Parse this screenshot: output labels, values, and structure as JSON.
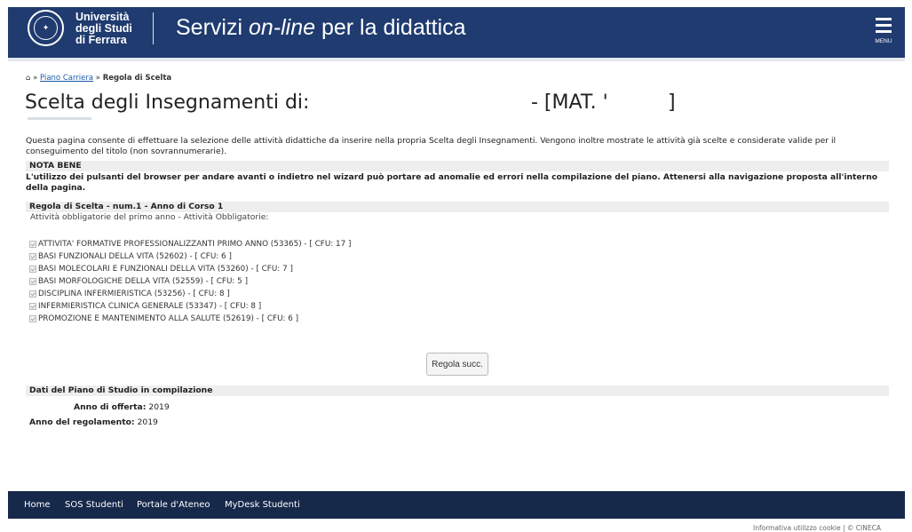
{
  "header": {
    "logo_line1": "Università",
    "logo_line2": "degli Studi",
    "logo_line3": "di Ferrara",
    "title_prefix": "Servizi ",
    "title_emph": "on-line",
    "title_suffix": " per la didattica",
    "menu_label": "MENU",
    "bg_color": "#1f3b6f"
  },
  "breadcrumb": {
    "home_icon": "home-icon",
    "sep1": "»",
    "link": "Piano Carriera",
    "sep2": "»",
    "current": "Regola di Scelta"
  },
  "page": {
    "title": "Scelta degli Insegnamenti di:",
    "mat_label": "- [MAT. '",
    "mat_close": "]",
    "intro": "Questa pagina consente di effettuare la selezione delle attività didattiche da inserire nella propria Scelta degli Insegnamenti. Vengono inoltre mostrate le attività già scelte e considerate valide per il conseguimento del titolo (non sovrannumerarie).",
    "nota_title": "NOTA BENE",
    "nota_text": "L'utilizzo dei pulsanti del browser per andare avanti o indietro nel wizard può portare ad anomalie ed errori nella compilazione del piano. Attenersi alla navigazione proposta all'interno della pagina.",
    "regola_title": "Regola di Scelta - num.1 - Anno di Corso 1",
    "regola_sub": "Attività obbligatorie del primo anno - Attività Obbligatorie:"
  },
  "activities": [
    "ATTIVITA' FORMATIVE PROFESSIONALIZZANTI PRIMO ANNO (53365) - [ CFU: 17 ]",
    "BASI FUNZIONALI DELLA VITA (52602) - [ CFU: 6 ]",
    "BASI MOLECOLARI E FUNZIONALI DELLA VITA (53260) - [ CFU: 7 ]",
    "BASI MORFOLOGICHE DELLA VITA (52559) - [ CFU: 5 ]",
    "DISCIPLINA INFERMIERISTICA (53256) - [ CFU: 8 ]",
    "INFERMIERISTICA CLINICA GENERALE (53347) - [ CFU: 8 ]",
    "PROMOZIONE E MANTENIMENTO ALLA SALUTE (52619) - [ CFU: 6 ]"
  ],
  "buttons": {
    "next": "Regola succ."
  },
  "dati": {
    "title": "Dati del Piano di Studio in compilazione",
    "anno_offerta_label": "Anno di offerta:",
    "anno_offerta_value": "2019",
    "anno_regolamento_label": "Anno del regolamento:",
    "anno_regolamento_value": "2019"
  },
  "footer": {
    "links": [
      "Home",
      "SOS Studenti",
      "Portale d'Ateneo",
      "MyDesk Studenti"
    ],
    "cookie": "Informativa utilizzo cookie | © CINECA",
    "bg_color": "#16294b"
  }
}
